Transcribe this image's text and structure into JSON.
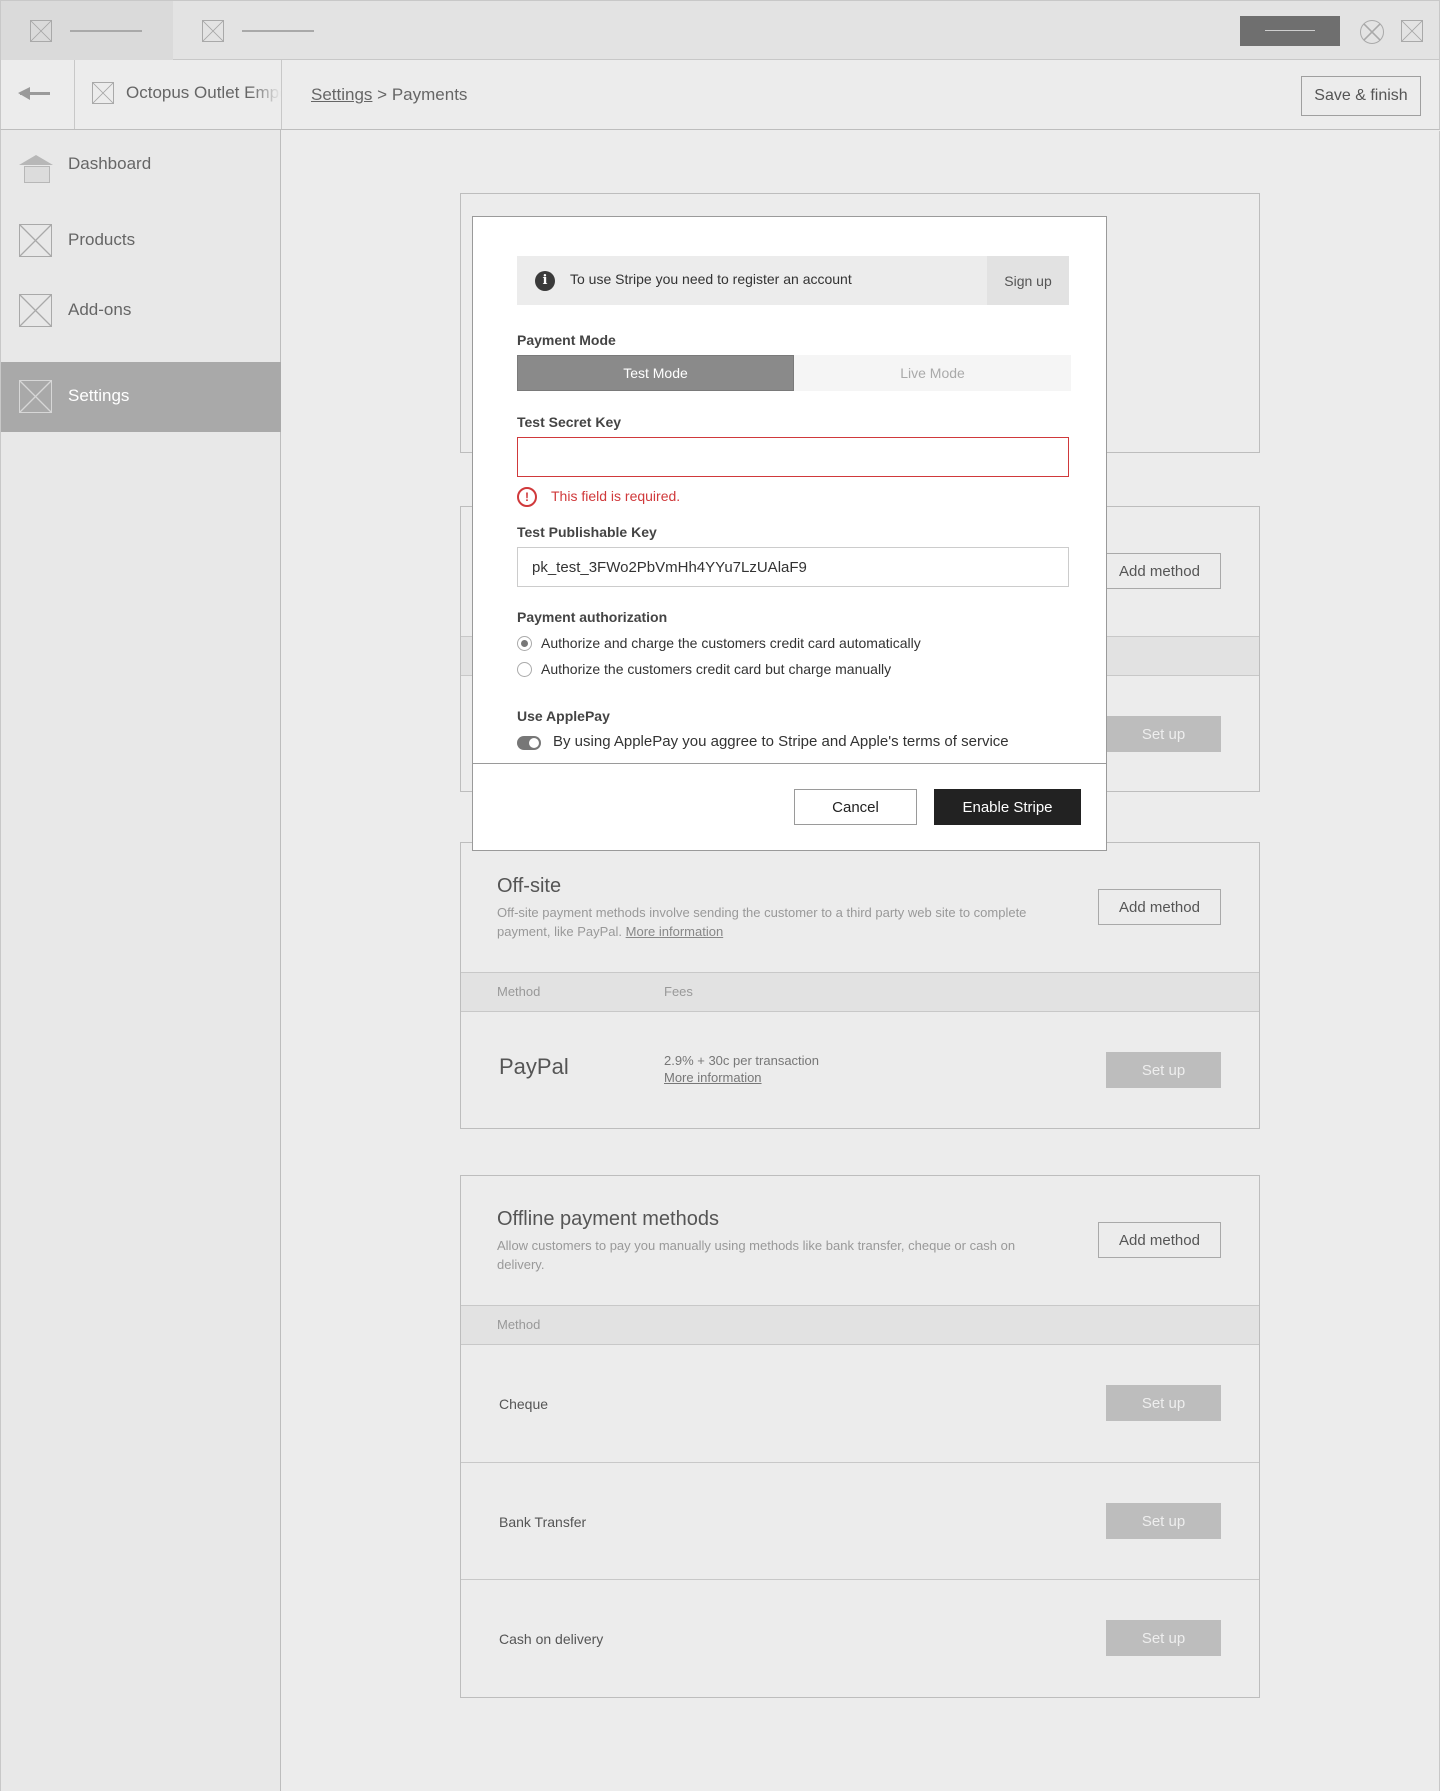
{
  "header": {
    "store_name": "Octopus Outlet Emporium",
    "breadcrumb_link": "Settings",
    "breadcrumb_sep": ">",
    "breadcrumb_current": "Payments",
    "save_label": "Save & finish"
  },
  "sidebar": {
    "items": [
      {
        "label": "Dashboard"
      },
      {
        "label": "Products"
      },
      {
        "label": "Add-ons"
      },
      {
        "label": "Settings"
      }
    ]
  },
  "cards": {
    "card2": {
      "add_label": "Add method",
      "setup_label": "Set up"
    },
    "offsite": {
      "title": "Off-site",
      "desc": "Off-site payment methods involve sending the customer to a third party web site to complete payment, like PayPal.",
      "desc_link": "More information",
      "add_label": "Add method",
      "col_method": "Method",
      "col_fees": "Fees",
      "row": {
        "name": "PayPal",
        "fee": "2.9% + 30c per transaction",
        "fee_link": "More information",
        "setup_label": "Set up"
      }
    },
    "offline": {
      "title": "Offline payment methods",
      "desc": "Allow customers to pay you manually using methods like bank transfer, cheque or cash on delivery.",
      "add_label": "Add method",
      "col_method": "Method",
      "rows": [
        {
          "name": "Cheque",
          "setup_label": "Set up"
        },
        {
          "name": "Bank Transfer",
          "setup_label": "Set up"
        },
        {
          "name": "Cash on delivery",
          "setup_label": "Set up"
        }
      ]
    }
  },
  "modal": {
    "notice": "To use Stripe you need to register an account",
    "signup_label": "Sign up",
    "payment_mode_label": "Payment Mode",
    "mode_test": "Test Mode",
    "mode_live": "Live Mode",
    "selected_mode": "Test Mode",
    "secret_label": "Test Secret Key",
    "secret_value": "",
    "error_text": "This field is required.",
    "publishable_label": "Test Publishable Key",
    "publishable_value": "pk_test_3FWo2PbVmHh4YYu7LzUAlaF9",
    "auth_label": "Payment authorization",
    "auth_options": [
      {
        "label": "Authorize and charge the customers credit card automatically",
        "checked": true
      },
      {
        "label": "Authorize the customers credit card but charge manually",
        "checked": false
      }
    ],
    "applepay_label": "Use ApplePay",
    "applepay_text": "By using ApplePay you aggree to Stripe and Apple's terms of service",
    "applepay_on": true,
    "cancel_label": "Cancel",
    "enable_label": "Enable Stripe"
  },
  "colors": {
    "error": "#d0393b",
    "primary_button": "#222222",
    "active_nav": "#a9a9a9"
  }
}
